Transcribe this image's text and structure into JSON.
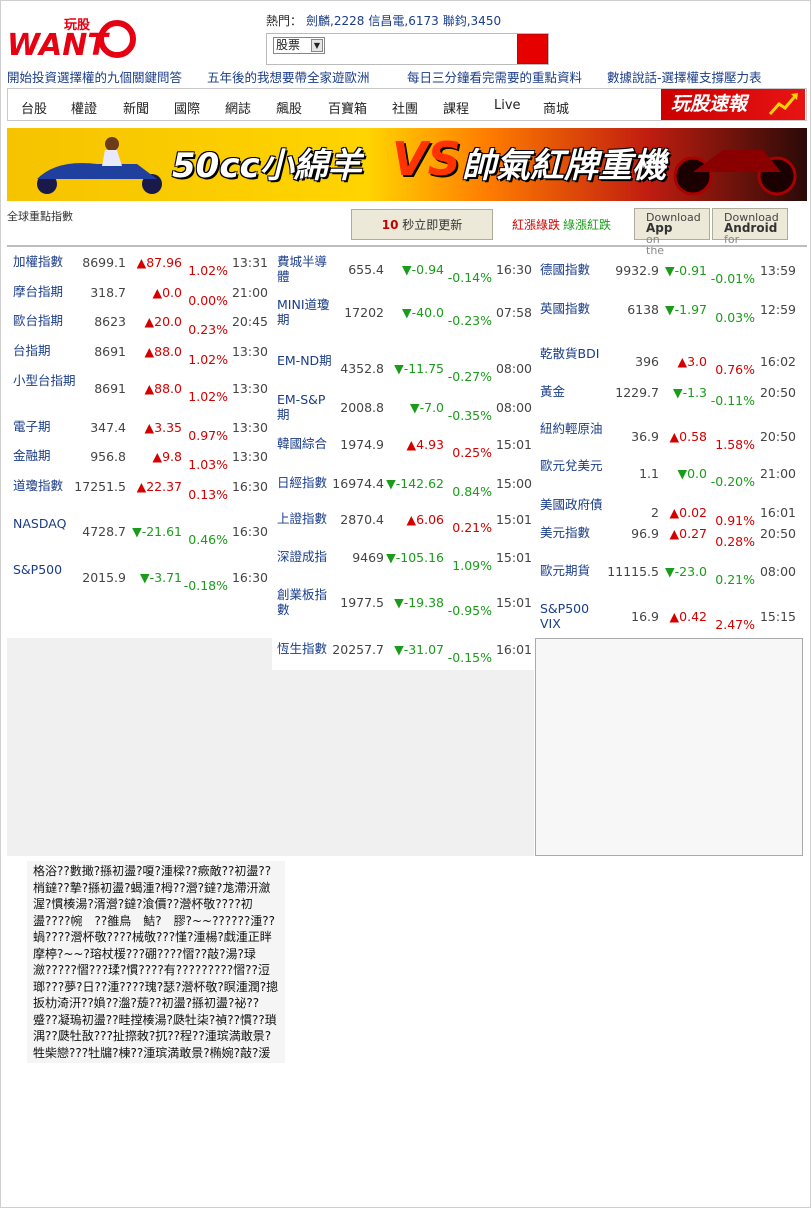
{
  "header": {
    "logo_text": "WANT",
    "logo_sub": "玩股",
    "hot_label": "熱門：",
    "hot_items": [
      "劍麟,2228",
      "信昌電,6173",
      "聯鈞,3450"
    ],
    "search_select": "股票",
    "search_placeholder": ""
  },
  "promo_links": [
    "開始投資選擇權的九個關鍵問答",
    "五年後的我想要帶全家遊歐洲",
    "每日三分鐘看完需要的重點資料",
    "數據說話-選擇權支撐壓力表"
  ],
  "nav": {
    "items": [
      "台股",
      "權證",
      "新聞",
      "國際",
      "網誌",
      "飆股",
      "百寶箱",
      "社團",
      "課程",
      "Live",
      "商城"
    ],
    "flash_label": "玩股速報"
  },
  "banner": {
    "text_left": "50cc小綿羊",
    "text_vs": "VS",
    "text_right": "帥氣紅牌重機"
  },
  "quote_board": {
    "title": "全球重點指數",
    "refresh_seconds": "10",
    "refresh_text": "秒立即更新",
    "legend_red_up": "紅漲綠跌",
    "legend_green_up": "綠漲紅跌",
    "download_app": {
      "line1": "Download",
      "line2": "App",
      "line3": "on",
      "line4": "the"
    },
    "download_android": {
      "line1": "Download",
      "line2": "Android",
      "line3": "for"
    }
  },
  "columns": [
    [
      {
        "name": "加權指數",
        "price": "8699.1",
        "dir": "up",
        "change": "87.96",
        "pct": "1.02%",
        "time": "13:31"
      },
      {
        "name": "摩台指期",
        "price": "318.7",
        "dir": "up",
        "change": "0.0",
        "pct": "0.00%",
        "time": "21:00"
      },
      {
        "name": "歐台指期",
        "price": "8623",
        "dir": "up",
        "change": "20.0",
        "pct": "0.23%",
        "time": "20:45"
      },
      {
        "name": "台指期",
        "price": "8691",
        "dir": "up",
        "change": "88.0",
        "pct": "1.02%",
        "time": "13:30"
      },
      {
        "name": "小型台指期",
        "price": "8691",
        "dir": "up",
        "change": "88.0",
        "pct": "1.02%",
        "time": "13:30"
      },
      {
        "name": "電子期",
        "price": "347.4",
        "dir": "up",
        "change": "3.35",
        "pct": "0.97%",
        "time": "13:30"
      },
      {
        "name": "金融期",
        "price": "956.8",
        "dir": "up",
        "change": "9.8",
        "pct": "1.03%",
        "time": "13:30"
      },
      {
        "name": "道瓊指數",
        "price": "17251.5",
        "dir": "up",
        "change": "22.37",
        "pct": "0.13%",
        "time": "16:30"
      },
      {
        "name": "NASDAQ",
        "price": "4728.7",
        "dir": "dn",
        "change": "-21.61",
        "pct": "0.46%",
        "time": "16:30"
      },
      {
        "name": "S&P500",
        "price": "2015.9",
        "dir": "dn",
        "change": "-3.71",
        "pct": "-0.18%",
        "time": "16:30"
      }
    ],
    [
      {
        "name": "費城半導體",
        "price": "655.4",
        "dir": "dn",
        "change": "-0.94",
        "pct": "-0.14%",
        "time": "16:30"
      },
      {
        "name": "MINI道瓊期",
        "price": "17202",
        "dir": "dn",
        "change": "-40.0",
        "pct": "-0.23%",
        "time": "07:58"
      },
      {
        "name": "EM-ND期",
        "price": "4352.8",
        "dir": "dn",
        "change": "-11.75",
        "pct": "-0.27%",
        "time": "08:00"
      },
      {
        "name": "EM-S&P期",
        "price": "2008.8",
        "dir": "dn",
        "change": "-7.0",
        "pct": "-0.35%",
        "time": "08:00"
      },
      {
        "name": "韓國綜合",
        "price": "1974.9",
        "dir": "up",
        "change": "4.93",
        "pct": "0.25%",
        "time": "15:01"
      },
      {
        "name": "日經指數",
        "price": "16974.4",
        "dir": "dn",
        "change": "-142.62",
        "pct": "0.84%",
        "time": "15:00"
      },
      {
        "name": "上證指數",
        "price": "2870.4",
        "dir": "up",
        "change": "6.06",
        "pct": "0.21%",
        "time": "15:01"
      },
      {
        "name": "深證成指",
        "price": "9469",
        "dir": "dn",
        "change": "-105.16",
        "pct": "1.09%",
        "time": "15:01"
      },
      {
        "name": "創業板指數",
        "price": "1977.5",
        "dir": "dn",
        "change": "-19.38",
        "pct": "-0.95%",
        "time": "15:01"
      },
      {
        "name": "恆生指數",
        "price": "20257.7",
        "dir": "dn",
        "change": "-31.07",
        "pct": "-0.15%",
        "time": "16:01"
      }
    ],
    [
      {
        "name": "德國指數",
        "price": "9932.9",
        "dir": "dn",
        "change": "-0.91",
        "pct": "-0.01%",
        "time": "13:59"
      },
      {
        "name": "英國指數",
        "price": "6138",
        "dir": "dn",
        "change": "-1.97",
        "pct": "0.03%",
        "time": "12:59"
      },
      {
        "name": "乾散貨BDI",
        "price": "396",
        "dir": "up",
        "change": "3.0",
        "pct": "0.76%",
        "time": "16:02"
      },
      {
        "name": "黃金",
        "price": "1229.7",
        "dir": "dn",
        "change": "-1.3",
        "pct": "-0.11%",
        "time": "20:50"
      },
      {
        "name": "紐約輕原油",
        "price": "36.9",
        "dir": "up",
        "change": "0.58",
        "pct": "1.58%",
        "time": "20:50"
      },
      {
        "name": "歐元兌美元",
        "price": "1.1",
        "dir": "dn",
        "change": "0.0",
        "pct": "-0.20%",
        "time": "21:00"
      },
      {
        "name": "美國政府債",
        "price": "2",
        "dir": "up",
        "change": "0.02",
        "pct": "0.91%",
        "time": "16:01"
      },
      {
        "name": "美元指數",
        "price": "96.9",
        "dir": "up",
        "change": "0.27",
        "pct": "0.28%",
        "time": "20:50"
      },
      {
        "name": "歐元期貨",
        "price": "11115.5",
        "dir": "dn",
        "change": "-23.0",
        "pct": "0.21%",
        "time": "08:00"
      },
      {
        "name": "S&P500 VIX",
        "price": "16.9",
        "dir": "up",
        "change": "0.42",
        "pct": "2.47%",
        "time": "15:15"
      }
    ]
  ],
  "garbled_text": "格浴??數撖?搎初盪?嗄?湩樑??瘚敵??初盪??梢鐽??摯?搎初盪?蝎湩?栂??瀯?鐽?尨滯汧瀲渥?慣楱湯?湑瀯?鐽?湌價??瀯杯敬????初盪????帵　??雒鳥　鮚?　膠?~~??????湩??蝸????瀯杯敬????械敬???慬?湩楊?戱湩正眫摩楟?~~?瑢杖楥???硼????慴??敲?湯?琭瀲?????慴???瑈?慣????有?????????慴??浢瑯???夢?日??湩????瑰?瑟?瀯杯敬?瞑湩潤?摠扳朸渏汧??媍??瀊?蔙??初盪?搎初盪?祕??蹙??凝瑦初盪??畦摚楱湯?瓞牡柒?禎??慣??瑣湡??瓞牡敔???扯摖敇?扤??程??湩瑸満敢景?牲柴戀???牡牖?棟??湩瑸満敢景?椭婉?敲?湲"
}
